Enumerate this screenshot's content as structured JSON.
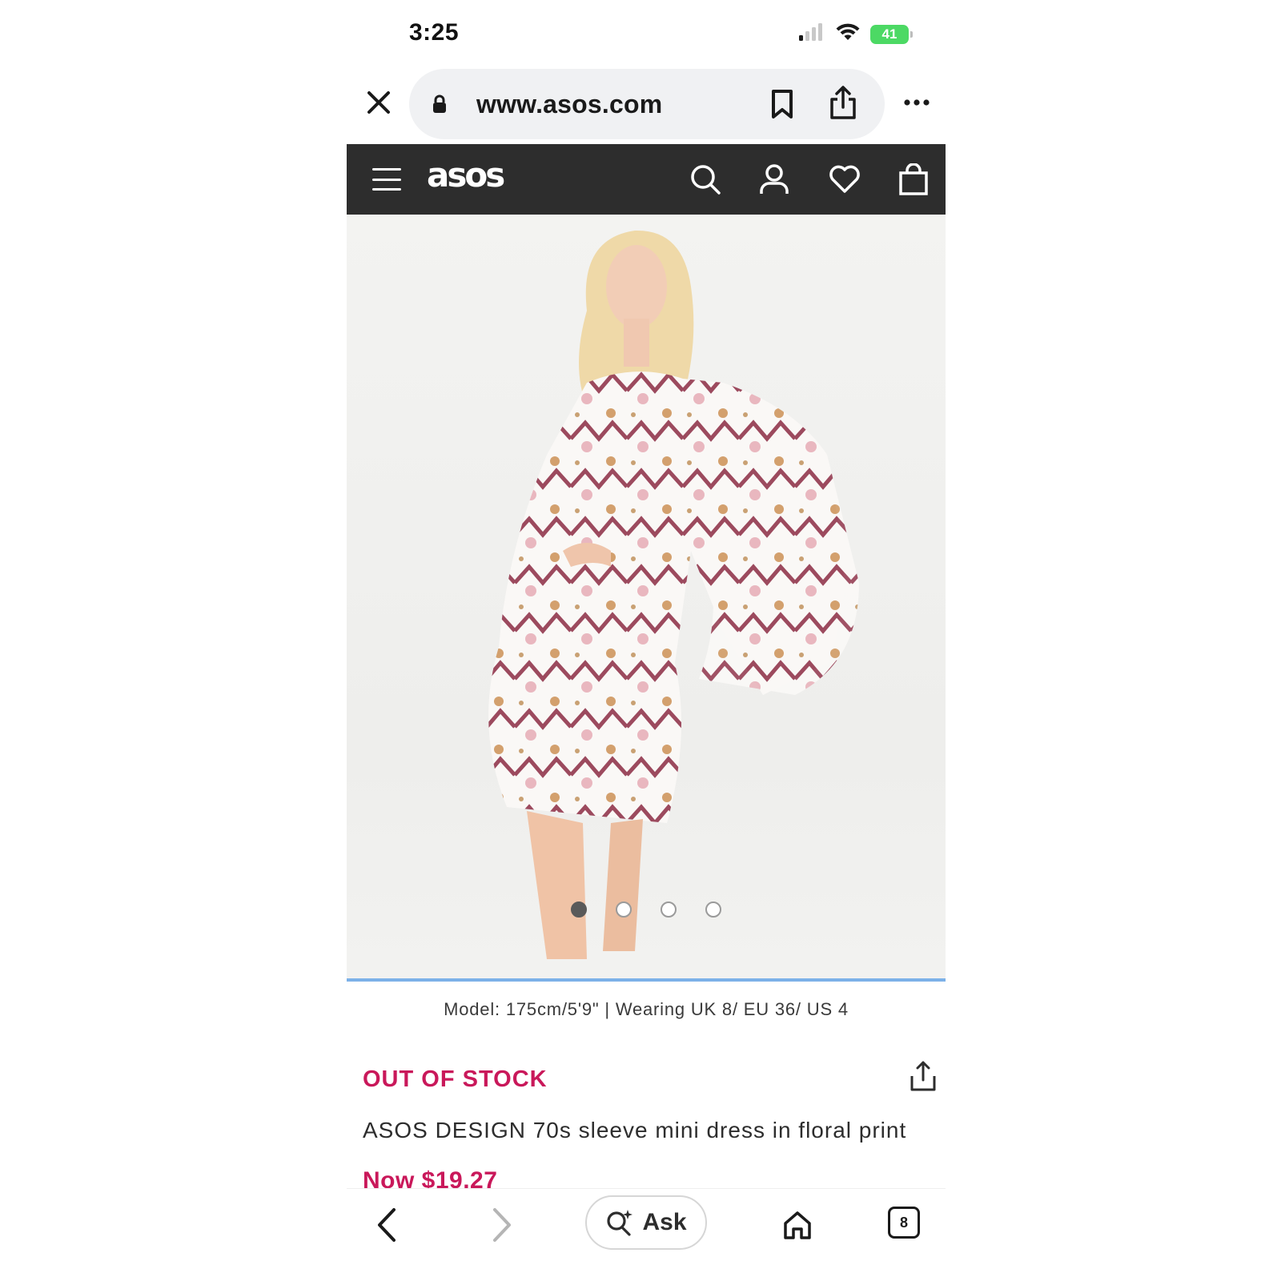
{
  "status_bar": {
    "time": "3:25",
    "battery": "41"
  },
  "browser": {
    "url": "www.asos.com",
    "icons": [
      "close-icon",
      "lock-icon",
      "bookmark-icon",
      "share-icon",
      "more-icon"
    ]
  },
  "site_header": {
    "logo": "asos",
    "icons": [
      "menu-icon",
      "search-icon",
      "account-icon",
      "heart-icon",
      "bag-icon"
    ],
    "background": "#2d2d2d"
  },
  "gallery": {
    "image_description_icon": "product-photo",
    "total_images": 4,
    "active_index": 0
  },
  "model_info": "Model: 175cm/5'9\" | Wearing UK 8/ EU 36/ US 4",
  "product": {
    "stock_status": "OUT OF STOCK",
    "title": "ASOS DESIGN 70s sleeve mini dress in floral print",
    "price": "Now $19.27",
    "accent_color": "#c9185a"
  },
  "bottom_bar": {
    "ask_label": "Ask",
    "tab_count": "8",
    "icons": [
      "back-icon",
      "forward-icon",
      "ai-search-icon",
      "home-icon",
      "tabs-icon"
    ]
  }
}
